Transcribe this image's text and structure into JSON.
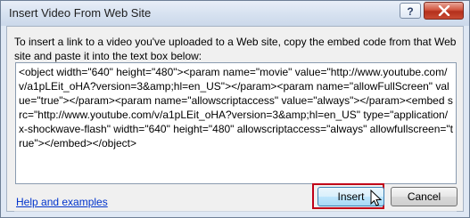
{
  "window": {
    "title": "Insert Video From Web Site",
    "help_glyph": "?",
    "close_icon": "close-icon"
  },
  "instructions": "To insert a link to a video you've uploaded to a Web site, copy the embed code from that Web site and paste it into the text box below:",
  "embed_code": "<object width=\"640\" height=\"480\"><param name=\"movie\" value=\"http://www.youtube.com/v/a1pLEit_oHA?version=3&amp;hl=en_US\"></param><param name=\"allowFullScreen\" value=\"true\"></param><param name=\"allowscriptaccess\" value=\"always\"></param><embed src=\"http://www.youtube.com/v/a1pLEit_oHA?version=3&amp;hl=en_US\" type=\"application/x-shockwave-flash\" width=\"640\" height=\"480\" allowscriptaccess=\"always\" allowfullscreen=\"true\"></embed></object>",
  "help_link": "Help and examples",
  "buttons": {
    "insert_label": "Insert",
    "cancel_label": "Cancel"
  },
  "colors": {
    "highlight_outline": "#c00018",
    "link": "#0033cc"
  }
}
